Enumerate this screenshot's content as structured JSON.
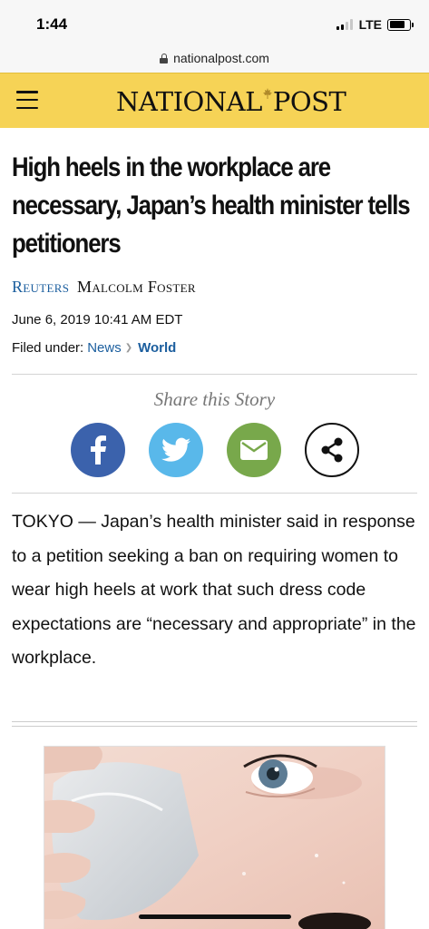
{
  "status_bar": {
    "time": "1:44",
    "network": "LTE"
  },
  "browser": {
    "url": "nationalpost.com"
  },
  "header": {
    "logo_left": "NATIONAL",
    "logo_right": "POST",
    "background_color": "#f6d356"
  },
  "article": {
    "headline": "High heels in the workplace are necessary, Japan’s health minister tells petitioners",
    "byline": {
      "source": "Reuters",
      "author": "Malcolm Foster"
    },
    "date": "June 6, 2019 10:41 AM EDT",
    "filed_under": {
      "label": "Filed under:",
      "category": "News",
      "subcategory": "World"
    },
    "share": {
      "title": "Share this Story",
      "buttons": [
        "facebook-icon",
        "twitter-icon",
        "email-icon",
        "share-icon"
      ]
    },
    "body": "TOKYO — Japan’s health minister said in response to a petition seeking a ban on requiring women to wear high heels at work that such dress code expectations are “necessary and appropriate” in the workplace."
  },
  "colors": {
    "link": "#1b5e9e",
    "facebook": "#3b62ac",
    "twitter": "#59b8ea",
    "email": "#78a84b"
  }
}
